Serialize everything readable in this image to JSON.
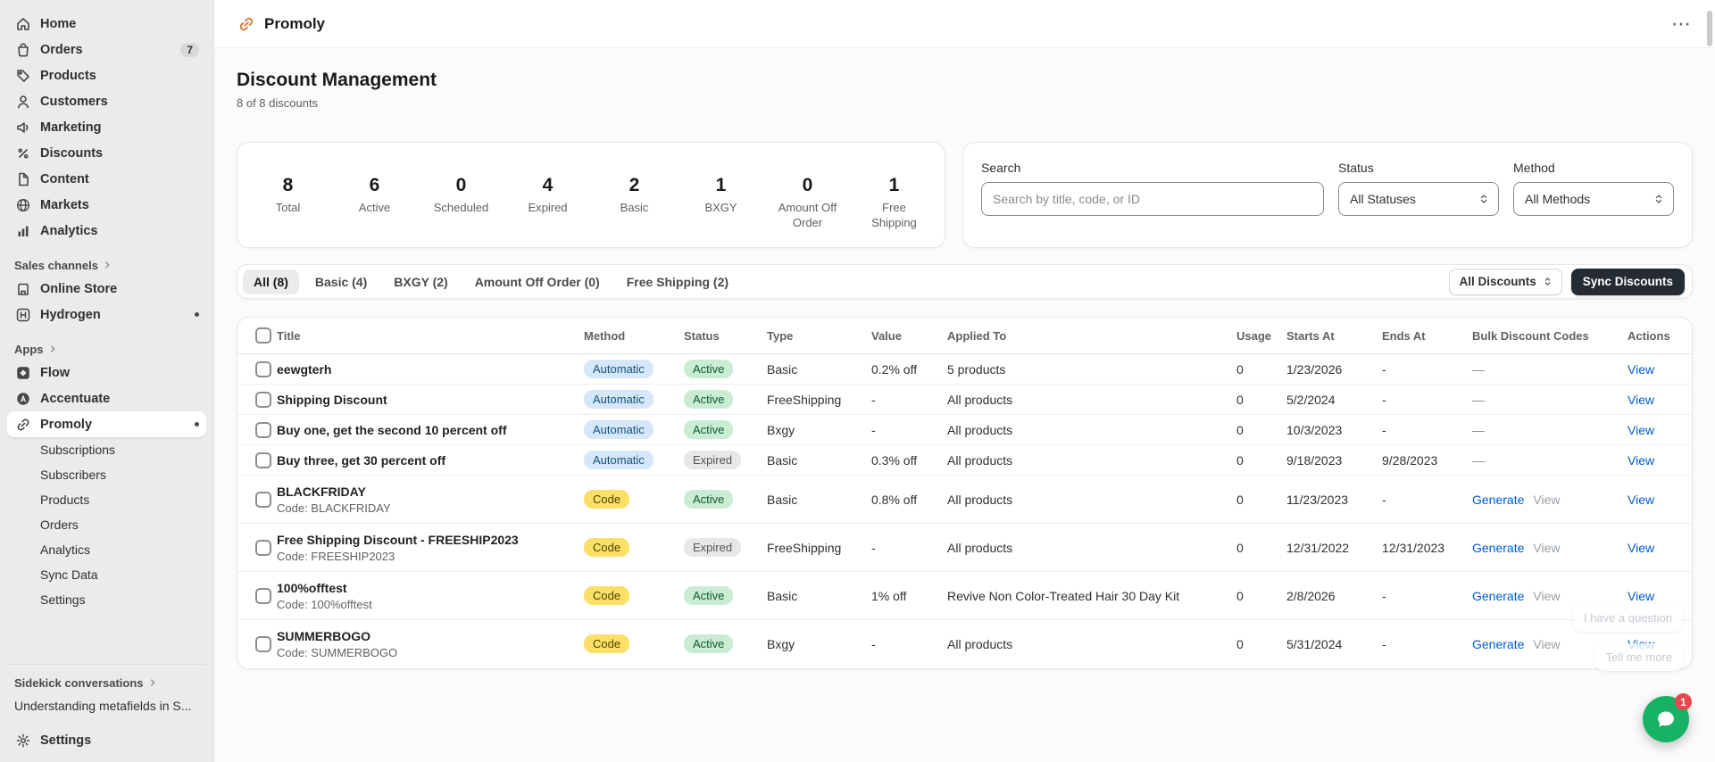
{
  "colors": {
    "link": "#005bd3",
    "brand_orange": "#dd7d3b",
    "badge_automatic_bg": "#d5e7f8",
    "badge_code_bg": "#fbdf66",
    "badge_active_bg": "#c9ecd2",
    "badge_expired_bg": "#e7e7e7",
    "sync_button_bg": "#252b33",
    "chat_green": "#16b364",
    "sidebar_bg": "#ebebeb"
  },
  "sidebar": {
    "nav": [
      {
        "label": "Home"
      },
      {
        "label": "Orders",
        "badge": "7"
      },
      {
        "label": "Products"
      },
      {
        "label": "Customers"
      },
      {
        "label": "Marketing"
      },
      {
        "label": "Discounts"
      },
      {
        "label": "Content"
      },
      {
        "label": "Markets"
      },
      {
        "label": "Analytics"
      }
    ],
    "sales_channels": {
      "header": "Sales channels",
      "items": [
        {
          "label": "Online Store"
        },
        {
          "label": "Hydrogen"
        }
      ]
    },
    "apps": {
      "header": "Apps",
      "items": [
        {
          "label": "Flow"
        },
        {
          "label": "Accentuate"
        },
        {
          "label": "Promoly"
        }
      ],
      "promoly_subitems": [
        {
          "label": "Subscriptions"
        },
        {
          "label": "Subscribers"
        },
        {
          "label": "Products"
        },
        {
          "label": "Orders"
        },
        {
          "label": "Analytics"
        },
        {
          "label": "Sync Data"
        },
        {
          "label": "Settings"
        }
      ]
    },
    "sidekick": {
      "header": "Sidekick conversations",
      "conversation": "Understanding metafields in S..."
    },
    "settings_label": "Settings"
  },
  "topbar": {
    "app_title": "Promoly",
    "more_button": "⋯"
  },
  "page": {
    "title": "Discount Management",
    "subtitle": "8 of 8 discounts"
  },
  "stats": [
    {
      "value": "8",
      "label": "Total"
    },
    {
      "value": "6",
      "label": "Active"
    },
    {
      "value": "0",
      "label": "Scheduled"
    },
    {
      "value": "4",
      "label": "Expired"
    },
    {
      "value": "2",
      "label": "Basic"
    },
    {
      "value": "1",
      "label": "BXGY"
    },
    {
      "value": "0",
      "label": "Amount Off Order"
    },
    {
      "value": "1",
      "label": "Free Shipping"
    }
  ],
  "filters": {
    "search_label": "Search",
    "search_placeholder": "Search by title, code, or ID",
    "status_label": "Status",
    "status_value": "All Statuses",
    "method_label": "Method",
    "method_value": "All Methods"
  },
  "tabs": [
    {
      "label": "All (8)",
      "active": true
    },
    {
      "label": "Basic (4)"
    },
    {
      "label": "BXGY (2)"
    },
    {
      "label": "Amount Off Order (0)"
    },
    {
      "label": "Free Shipping (2)"
    }
  ],
  "toolbar": {
    "scope_selector": "All Discounts",
    "sync_button": "Sync Discounts"
  },
  "table": {
    "columns": [
      "Title",
      "Method",
      "Status",
      "Type",
      "Value",
      "Applied To",
      "Usage",
      "Starts At",
      "Ends At",
      "Bulk Discount Codes",
      "Actions"
    ],
    "bulk_generate_label": "Generate",
    "bulk_view_label": "View",
    "bulk_empty": "—",
    "action_label": "View",
    "rows": [
      {
        "title": "eewgterh",
        "code": "",
        "method": "Automatic",
        "status": "Active",
        "type": "Basic",
        "value": "0.2% off",
        "applied_to": "5 products",
        "usage": "0",
        "starts_at": "1/23/2026",
        "ends_at": "-",
        "has_codes": false
      },
      {
        "title": "Shipping Discount",
        "code": "",
        "method": "Automatic",
        "status": "Active",
        "type": "FreeShipping",
        "value": "-",
        "applied_to": "All products",
        "usage": "0",
        "starts_at": "5/2/2024",
        "ends_at": "-",
        "has_codes": false
      },
      {
        "title": "Buy one, get the second 10 percent off",
        "code": "",
        "method": "Automatic",
        "status": "Active",
        "type": "Bxgy",
        "value": "-",
        "applied_to": "All products",
        "usage": "0",
        "starts_at": "10/3/2023",
        "ends_at": "-",
        "has_codes": false
      },
      {
        "title": "Buy three, get 30 percent off",
        "code": "",
        "method": "Automatic",
        "status": "Expired",
        "type": "Basic",
        "value": "0.3% off",
        "applied_to": "All products",
        "usage": "0",
        "starts_at": "9/18/2023",
        "ends_at": "9/28/2023",
        "has_codes": false
      },
      {
        "title": "BLACKFRIDAY",
        "code": "Code: BLACKFRIDAY",
        "method": "Code",
        "status": "Active",
        "type": "Basic",
        "value": "0.8% off",
        "applied_to": "All products",
        "usage": "0",
        "starts_at": "11/23/2023",
        "ends_at": "-",
        "has_codes": true
      },
      {
        "title": "Free Shipping Discount - FREESHIP2023",
        "code": "Code: FREESHIP2023",
        "method": "Code",
        "status": "Expired",
        "type": "FreeShipping",
        "value": "-",
        "applied_to": "All products",
        "usage": "0",
        "starts_at": "12/31/2022",
        "ends_at": "12/31/2023",
        "has_codes": true
      },
      {
        "title": "100%offtest",
        "code": "Code: 100%offtest",
        "method": "Code",
        "status": "Active",
        "type": "Basic",
        "value": "1% off",
        "applied_to": "Revive Non Color-Treated Hair 30 Day Kit",
        "usage": "0",
        "starts_at": "2/8/2026",
        "ends_at": "-",
        "has_codes": true
      },
      {
        "title": "SUMMERBOGO",
        "code": "Code: SUMMERBOGO",
        "method": "Code",
        "status": "Active",
        "type": "Bxgy",
        "value": "-",
        "applied_to": "All products",
        "usage": "0",
        "starts_at": "5/31/2024",
        "ends_at": "-",
        "has_codes": true
      }
    ]
  },
  "chat": {
    "unread_count": "1",
    "tooltip_question": "I have a question",
    "tooltip_more": "Tell me more"
  }
}
